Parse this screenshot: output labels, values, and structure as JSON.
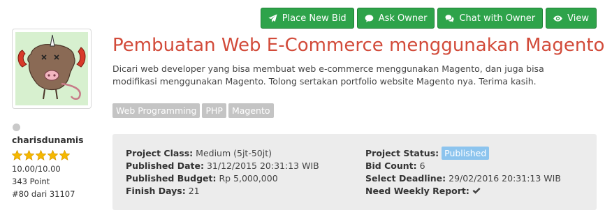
{
  "actions": {
    "place_bid": "Place New Bid",
    "ask_owner": "Ask Owner",
    "chat_owner": "Chat with Owner",
    "view": "View"
  },
  "owner": {
    "username": "charisdunamis",
    "rating_stars": 5,
    "rating": "10.00/10.00",
    "points": "343 Point",
    "rank": "#80 dari 31107",
    "status_color": "#c9c9c9"
  },
  "project": {
    "title": "Pembuatan Web E-Commerce menggunakan Magento",
    "description": "Dicari web developer yang bisa membuat web e-commerce menggunakan Magento, dan juga bisa modifikasi menggunakan Magento. Tolong sertakan portfolio website Magento nya. Terima kasih.",
    "tags": [
      "Web Programming",
      "PHP",
      "Magento"
    ]
  },
  "details": {
    "class_label": "Project Class:",
    "class_value": "Medium (5jt-50jt)",
    "published_date_label": "Published Date:",
    "published_date_value": "31/12/2015 20:31:13 WIB",
    "budget_label": "Published Budget:",
    "budget_value": "Rp 5,000,000",
    "finish_days_label": "Finish Days:",
    "finish_days_value": "21",
    "status_label": "Project Status:",
    "status_value": "Published",
    "bid_count_label": "Bid Count:",
    "bid_count_value": "6",
    "deadline_label": "Select Deadline:",
    "deadline_value": "29/02/2016 20:31:13 WIB",
    "weekly_report_label": "Need Weekly Report:",
    "weekly_report_icon": "check-icon"
  },
  "colors": {
    "button": "#2ea34a",
    "title": "#d24b3a",
    "tag": "#c4c4c4",
    "badge": "#8cc4ee",
    "panel": "#ececec",
    "star": "#f5b800"
  }
}
